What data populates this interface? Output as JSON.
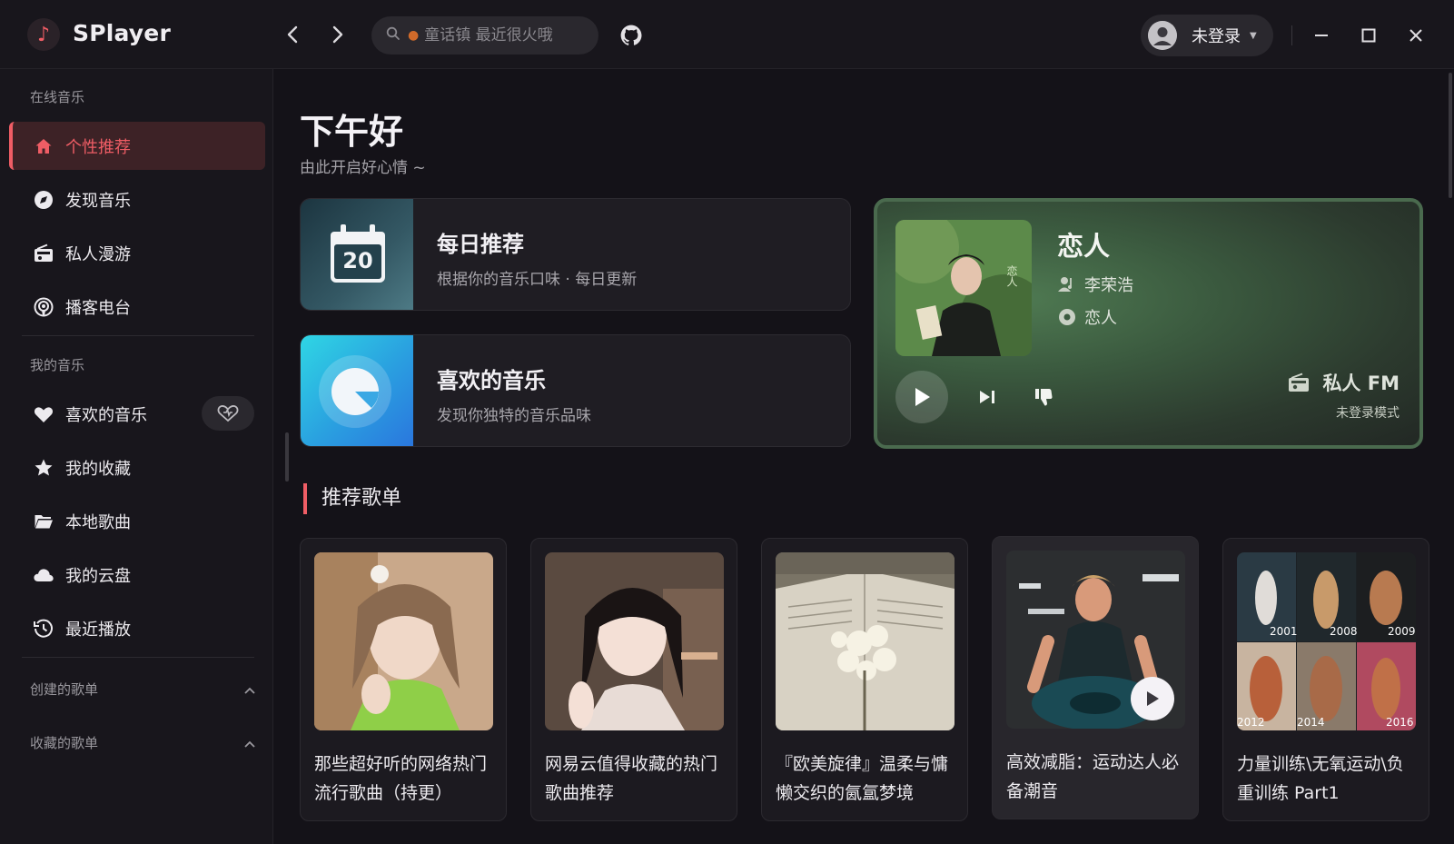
{
  "app": {
    "title": "SPlayer"
  },
  "search": {
    "placeholder": "童话镇 最近很火哦"
  },
  "user": {
    "name": "未登录"
  },
  "sidebar": {
    "online_section": "在线音乐",
    "online_items": [
      {
        "label": "个性推荐",
        "icon": "home-icon",
        "active": true
      },
      {
        "label": "发现音乐",
        "icon": "disc-icon"
      },
      {
        "label": "私人漫游",
        "icon": "radio-icon"
      },
      {
        "label": "播客电台",
        "icon": "podcast-icon"
      }
    ],
    "my_section": "我的音乐",
    "my_items": [
      {
        "label": "喜欢的音乐",
        "icon": "heart-icon"
      },
      {
        "label": "我的收藏",
        "icon": "star-icon"
      },
      {
        "label": "本地歌曲",
        "icon": "folder-icon"
      },
      {
        "label": "我的云盘",
        "icon": "cloud-icon"
      },
      {
        "label": "最近播放",
        "icon": "history-icon"
      }
    ],
    "created_playlists": "创建的歌单",
    "collected_playlists": "收藏的歌单"
  },
  "main": {
    "greeting": "下午好",
    "sub_greeting": "由此开启好心情 ~",
    "daily": {
      "title": "每日推荐",
      "subtitle": "根据你的音乐口味 · 每日更新",
      "day": "20"
    },
    "liked": {
      "title": "喜欢的音乐",
      "subtitle": "发现你独特的音乐品味"
    },
    "fm": {
      "song": "恋人",
      "artist": "李荣浩",
      "album": "恋人",
      "label": "私人 FM",
      "mode": "未登录模式"
    },
    "section_title": "推荐歌单",
    "playlists": [
      {
        "name": "那些超好听的网络热门流行歌曲（持更）"
      },
      {
        "name": "网易云值得收藏的热门歌曲推荐"
      },
      {
        "name": "『欧美旋律』温柔与慵懒交织的氤氲梦境"
      },
      {
        "name": "高效减脂：运动达人必备潮音"
      },
      {
        "name": "力量训练\\无氧运动\\负重训练 Part1"
      }
    ],
    "year_labels": [
      "2001",
      "2008",
      "2009",
      "2012",
      "2014",
      "2016"
    ]
  },
  "colors": {
    "accent": "#ef5d65",
    "background": "#141218",
    "sidebar": "#18161c"
  }
}
